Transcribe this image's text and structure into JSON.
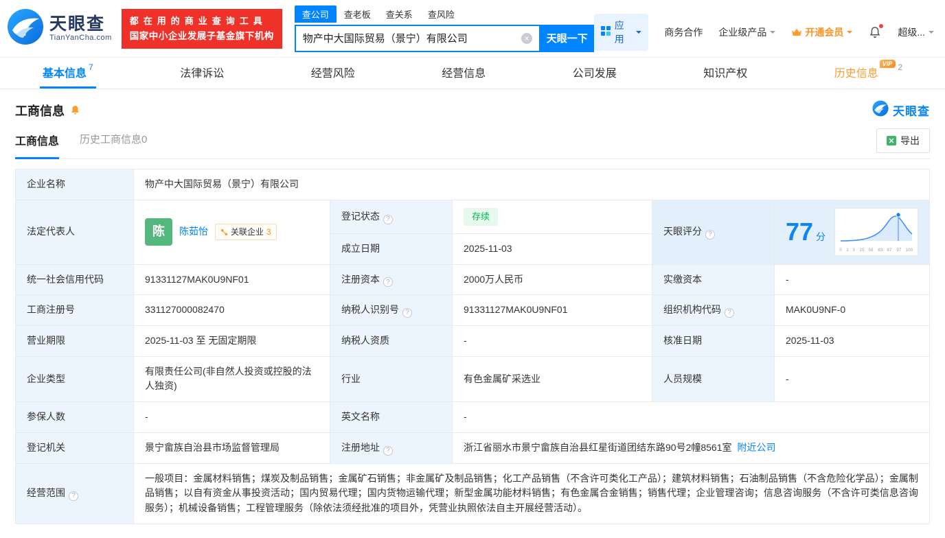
{
  "header": {
    "logo": {
      "title": "天眼查",
      "subtitle": "TianYanCha.com"
    },
    "promo": {
      "line1": "都在用的商业查询工具",
      "line2": "国家中小企业发展子基金旗下机构"
    },
    "search": {
      "tabs": [
        {
          "label": "查公司",
          "active": true
        },
        {
          "label": "查老板",
          "active": false
        },
        {
          "label": "查关系",
          "active": false
        },
        {
          "label": "查风险",
          "active": false
        }
      ],
      "value": "物产中大国际贸易（景宁）有限公司",
      "button_label": "天眼一下"
    },
    "right_nav": {
      "apps_label": "应用",
      "cooperation_label": "商务合作",
      "enterprise_label": "企业级产品",
      "vip_label": "开通会员",
      "super_label": "超级..."
    }
  },
  "nav_tabs": [
    {
      "label": "基本信息",
      "count": "7"
    },
    {
      "label": "法律诉讼"
    },
    {
      "label": "经营风险"
    },
    {
      "label": "经营信息"
    },
    {
      "label": "公司发展"
    },
    {
      "label": "知识产权"
    },
    {
      "label": "历史信息",
      "count": "2",
      "vip_badge": "VIP"
    }
  ],
  "section": {
    "title": "工商信息",
    "brand_logo_text": "天眼查",
    "subtabs": [
      {
        "label": "工商信息",
        "active": true
      },
      {
        "label": "历史工商信息0",
        "active": false
      }
    ],
    "export_label": "导出"
  },
  "fields": {
    "company_name_label": "企业名称",
    "company_name": "物产中大国际贸易（景宁）有限公司",
    "legal_rep_label": "法定代表人",
    "legal_rep_avatar": "陈",
    "legal_rep_name": "陈茹怡",
    "related_label": "关联企业",
    "related_count": "3",
    "reg_status_label": "登记状态",
    "reg_status": "存续",
    "score_label": "天眼评分",
    "score_value": "77",
    "score_unit": "分",
    "est_date_label": "成立日期",
    "est_date": "2025-11-03",
    "credit_code_label": "统一社会信用代码",
    "credit_code": "91331127MAK0U9NF01",
    "reg_capital_label": "注册资本",
    "reg_capital": "2000万人民币",
    "paid_capital_label": "实缴资本",
    "paid_capital": "-",
    "reg_no_label": "工商注册号",
    "reg_no": "331127000082470",
    "taxpayer_no_label": "纳税人识别号",
    "taxpayer_no": "91331127MAK0U9NF01",
    "org_code_label": "组织机构代码",
    "org_code": "MAK0U9NF-0",
    "term_label": "营业期限",
    "term": "2025-11-03 至 无固定期限",
    "taxpayer_quality_label": "纳税人资质",
    "taxpayer_quality": "-",
    "approve_date_label": "核准日期",
    "approve_date": "2025-11-03",
    "company_type_label": "企业类型",
    "company_type": "有限责任公司(非自然人投资或控股的法人独资)",
    "industry_label": "行业",
    "industry": "有色金属矿采选业",
    "staff_label": "人员规模",
    "staff": "-",
    "insured_label": "参保人数",
    "insured": "-",
    "en_name_label": "英文名称",
    "en_name": "-",
    "authority_label": "登记机关",
    "authority": "景宁畲族自治县市场监督管理局",
    "address_label": "注册地址",
    "address": "浙江省丽水市景宁畲族自治县红星街道团结东路90号2幢8561室",
    "nearby_label": "附近公司",
    "scope_label": "经营范围",
    "scope": "一般项目：金属材料销售；煤炭及制品销售；金属矿石销售；非金属矿及制品销售；化工产品销售（不含许可类化工产品）；建筑材料销售；石油制品销售（不含危险化学品）；金属制品销售；以自有资金从事投资活动；国内贸易代理；国内货物运输代理；新型金属功能材料销售；有色金属合金销售；销售代理；企业管理咨询；信息咨询服务（不含许可类信息咨询服务）；机械设备销售；工程管理服务（除依法须经批准的项目外，凭营业执照依法自主开展经营活动）。"
  },
  "chart_data": {
    "type": "area",
    "title": "天眼评分",
    "score": 77,
    "axis_ticks": [
      "0",
      "1",
      "3",
      "15",
      "50",
      "83",
      "87",
      "97",
      "100"
    ]
  }
}
